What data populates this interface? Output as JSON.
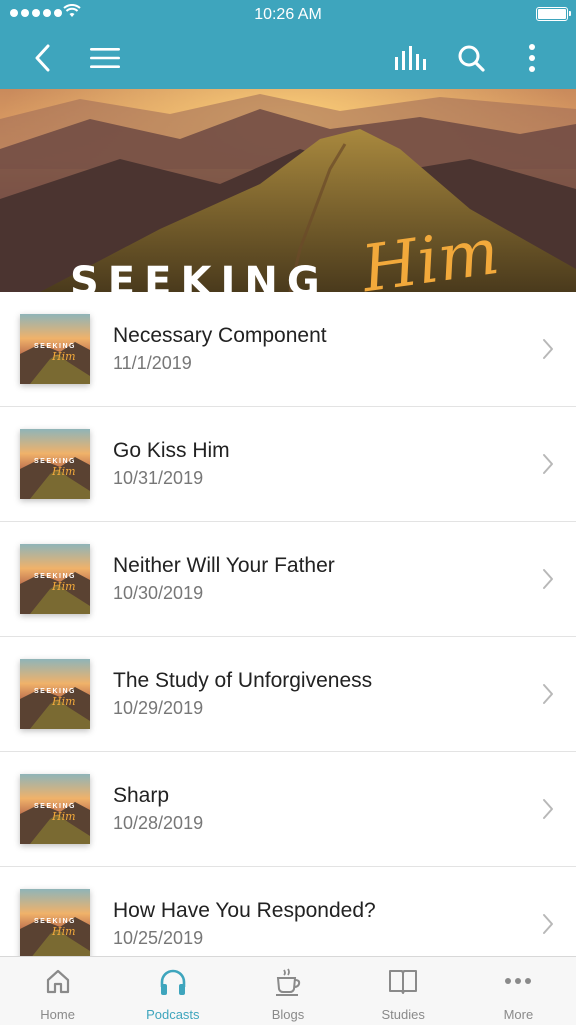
{
  "status_bar": {
    "time": "10:26 AM"
  },
  "navbar": {
    "back_icon": "chevron-left-icon",
    "menu_icon": "hamburger-icon",
    "audio_icon": "equalizer-icon",
    "search_icon": "search-icon",
    "more_icon": "more-vertical-icon",
    "accent_color": "#3ea5bd"
  },
  "hero": {
    "title_word": "SEEKING",
    "title_script": "Him"
  },
  "thumbnail": {
    "title_word": "SEEKING",
    "title_script": "Him"
  },
  "episodes": [
    {
      "title": "Necessary Component",
      "date": "11/1/2019"
    },
    {
      "title": "Go Kiss Him",
      "date": "10/31/2019"
    },
    {
      "title": "Neither Will Your Father",
      "date": "10/30/2019"
    },
    {
      "title": "The Study of Unforgiveness",
      "date": "10/29/2019"
    },
    {
      "title": "Sharp",
      "date": "10/28/2019"
    },
    {
      "title": "How Have You Responded?",
      "date": "10/25/2019"
    }
  ],
  "tabs": [
    {
      "label": "Home",
      "icon": "home-icon",
      "active": false
    },
    {
      "label": "Podcasts",
      "icon": "headphones-icon",
      "active": true
    },
    {
      "label": "Blogs",
      "icon": "coffee-cup-icon",
      "active": false
    },
    {
      "label": "Studies",
      "icon": "book-icon",
      "active": false
    },
    {
      "label": "More",
      "icon": "more-horizontal-icon",
      "active": false
    }
  ]
}
